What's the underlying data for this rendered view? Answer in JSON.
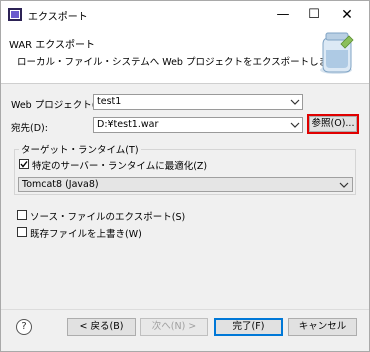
{
  "window": {
    "title": "エクスポート"
  },
  "header": {
    "title": "WAR エクスポート",
    "description": "ローカル・ファイル・システムへ Web プロジェクトをエクスポートします。"
  },
  "form": {
    "project_label": "Web プロジェクト(P):",
    "project_value": "test1",
    "destination_label": "宛先(D):",
    "destination_value": "D:¥test1.war",
    "browse_label": "参照(O)..."
  },
  "target_runtime": {
    "title": "ターゲット・ランタイム(T)",
    "optimize_label": "特定のサーバー・ランタイムに最適化(Z)",
    "optimize_checked": true,
    "runtime_value": "Tomcat8 (Java8)"
  },
  "options": {
    "export_source_label": "ソース・ファイルのエクスポート(S)",
    "export_source_checked": false,
    "overwrite_label": "既存ファイルを上書き(W)",
    "overwrite_checked": false
  },
  "footer": {
    "back_label": "< 戻る(B)",
    "next_label": "次へ(N) >",
    "finish_label": "完了(F)",
    "cancel_label": "キャンセル"
  },
  "colors": {
    "highlight": "#e00000",
    "accent": "#0078d7"
  },
  "icons": [
    "eclipse-app-icon",
    "minimize-icon",
    "maximize-icon",
    "close-icon",
    "jar-banner-icon",
    "chevron-down-icon",
    "checkmark-icon",
    "help-icon"
  ]
}
